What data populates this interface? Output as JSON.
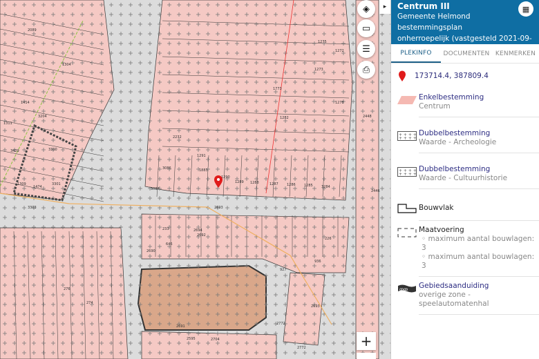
{
  "map": {
    "tools": [
      {
        "name": "layers",
        "icon": "layers-icon"
      },
      {
        "name": "measure",
        "icon": "ruler-icon"
      },
      {
        "name": "legend",
        "icon": "list-icon"
      },
      {
        "name": "print",
        "icon": "printer-icon"
      }
    ],
    "zoom_in": "+",
    "collapse": "▸",
    "parcel_labels": [
      "2089",
      "1304",
      "1414",
      "3204",
      "1311",
      "3300",
      "3429",
      "1309",
      "1474",
      "3301",
      "3303",
      "2232",
      "1291",
      "3086",
      "1883",
      "1290",
      "1289",
      "1288",
      "1287",
      "1286",
      "1285",
      "3284",
      "3087",
      "1275",
      "1273",
      "1773",
      "1282",
      "1278",
      "1272",
      "2448",
      "2446",
      "2693",
      "233",
      "2694",
      "2692",
      "646",
      "2690",
      "226",
      "936",
      "927",
      "2691",
      "2595",
      "2704",
      "2772",
      "2693",
      "276",
      "274",
      "2772"
    ],
    "colors": {
      "parcel": "#f5c9c4",
      "church": "#d9a78a",
      "background": "#dcdcdc",
      "marker": "#e01b1b"
    }
  },
  "panel": {
    "title": "Centrum III",
    "lines": [
      "Gemeente Helmond",
      "bestemmingsplan",
      "onherroepelijk (vastgesteld 2021-09-28)"
    ],
    "qr_icon": "qr-icon",
    "tabs": [
      {
        "label": "PLEKINFO",
        "active": true
      },
      {
        "label": "DOCUMENTEN",
        "active": false
      },
      {
        "label": "KENMERKEN",
        "active": false
      }
    ],
    "coordinates": "173714.4, 387809.4",
    "items": [
      {
        "title": "Enkelbestemming",
        "subs": [
          "Centrum"
        ],
        "icon": "parcel-swatch-icon"
      },
      {
        "title": "Dubbelbestemming",
        "subs": [
          "Waarde - Archeologie"
        ],
        "icon": "cross-pattern-icon"
      },
      {
        "title": "Dubbelbestemming",
        "subs": [
          "Waarde - Cultuurhistorie"
        ],
        "icon": "cross-pattern-icon"
      },
      {
        "title": "Bouwvlak",
        "subs": [],
        "icon": "building-plane-icon"
      },
      {
        "title": "Maatvoering",
        "subs": [
          "maximum aantal bouwlagen: 3",
          "maximum aantal bouwlagen: 3"
        ],
        "icon": "dashed-rect-icon"
      },
      {
        "title": "Gebiedsaanduiding",
        "subs": [
          "overige zone - speelautomatenhal"
        ],
        "icon": "zone-pattern-icon"
      }
    ]
  },
  "accent": "#0f6ea3"
}
